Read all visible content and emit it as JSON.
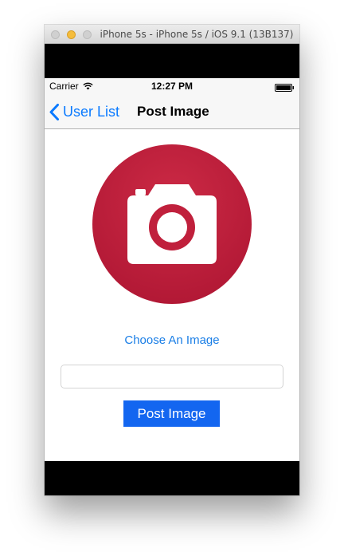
{
  "window": {
    "title": "iPhone 5s - iPhone 5s / iOS 9.1 (13B137)"
  },
  "status_bar": {
    "carrier": "Carrier",
    "time": "12:27 PM"
  },
  "nav_bar": {
    "back_label": "User List",
    "title": "Post Image"
  },
  "content": {
    "choose_image_label": "Choose An Image",
    "caption_value": "",
    "post_button_label": "Post Image"
  },
  "icons": {
    "back": "chevron-left-icon",
    "image_placeholder": "camera-icon",
    "wifi": "wifi-icon",
    "battery": "battery-icon"
  },
  "colors": {
    "ios_blue": "#0a7aff",
    "camera_circle": "#c0203c",
    "post_button_bg": "#1366f0"
  }
}
